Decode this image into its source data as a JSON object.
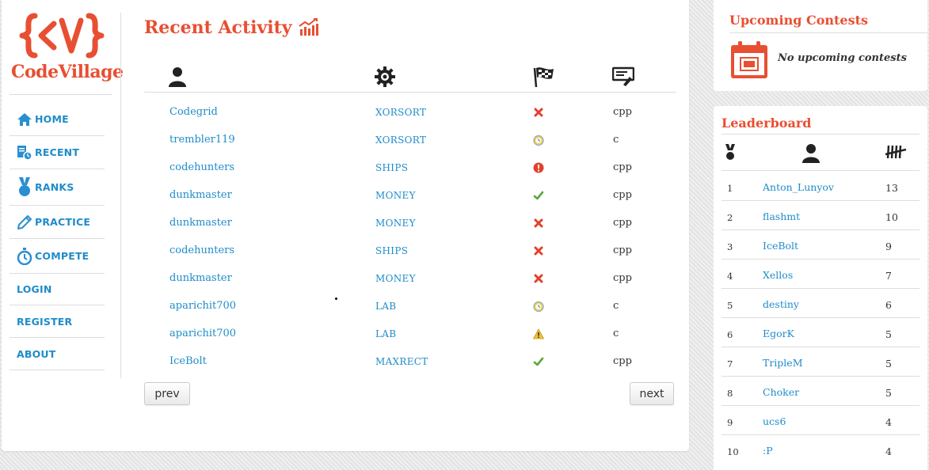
{
  "brand": {
    "name": "CodeVillage",
    "color": "#e84f32"
  },
  "nav": [
    {
      "label": "HOME",
      "icon": "home-icon"
    },
    {
      "label": "RECENT",
      "icon": "recent-icon"
    },
    {
      "label": "RANKS",
      "icon": "medal-icon"
    },
    {
      "label": "PRACTICE",
      "icon": "pencil-icon"
    },
    {
      "label": "COMPETE",
      "icon": "stopwatch-icon"
    },
    {
      "label": "LOGIN"
    },
    {
      "label": "REGISTER"
    },
    {
      "label": "ABOUT"
    }
  ],
  "activity": {
    "title": "Recent Activity",
    "columns": [
      "user-icon",
      "gear-icon",
      "checkered-flag-icon",
      "code-icon"
    ],
    "rows": [
      {
        "user": "Codegrid",
        "problem": "XORSORT",
        "status": "wrong",
        "lang": "cpp"
      },
      {
        "user": "trembler119",
        "problem": "XORSORT",
        "status": "timeout",
        "lang": "c"
      },
      {
        "user": "codehunters",
        "problem": "SHIPS",
        "status": "error",
        "lang": "cpp"
      },
      {
        "user": "dunkmaster",
        "problem": "MONEY",
        "status": "accepted",
        "lang": "cpp"
      },
      {
        "user": "dunkmaster",
        "problem": "MONEY",
        "status": "wrong",
        "lang": "cpp"
      },
      {
        "user": "codehunters",
        "problem": "SHIPS",
        "status": "wrong",
        "lang": "cpp"
      },
      {
        "user": "dunkmaster",
        "problem": "MONEY",
        "status": "wrong",
        "lang": "cpp"
      },
      {
        "user": "aparichit700",
        "problem": "LAB",
        "status": "timeout",
        "lang": "c"
      },
      {
        "user": "aparichit700",
        "problem": "LAB",
        "status": "warning",
        "lang": "c"
      },
      {
        "user": "IceBolt",
        "problem": "MAXRECT",
        "status": "accepted",
        "lang": "cpp"
      }
    ],
    "prev_label": "prev",
    "next_label": "next"
  },
  "contests": {
    "title": "Upcoming Contests",
    "message": "No upcoming contests"
  },
  "leaderboard": {
    "title": "Leaderboard",
    "rows": [
      {
        "rank": "1",
        "name": "Anton_Lunyov",
        "score": "13"
      },
      {
        "rank": "2",
        "name": "flashmt",
        "score": "10"
      },
      {
        "rank": "3",
        "name": "IceBolt",
        "score": "9"
      },
      {
        "rank": "4",
        "name": "Xellos",
        "score": "7"
      },
      {
        "rank": "5",
        "name": "destiny",
        "score": "6"
      },
      {
        "rank": "6",
        "name": "EgorK",
        "score": "5"
      },
      {
        "rank": "7",
        "name": "TripleM",
        "score": "5"
      },
      {
        "rank": "8",
        "name": "Choker",
        "score": "5"
      },
      {
        "rank": "9",
        "name": "ucs6",
        "score": "4"
      },
      {
        "rank": "10",
        "name": ":P",
        "score": "4"
      }
    ]
  },
  "colors": {
    "accent": "#e84f32",
    "link": "#1f8cc9"
  }
}
